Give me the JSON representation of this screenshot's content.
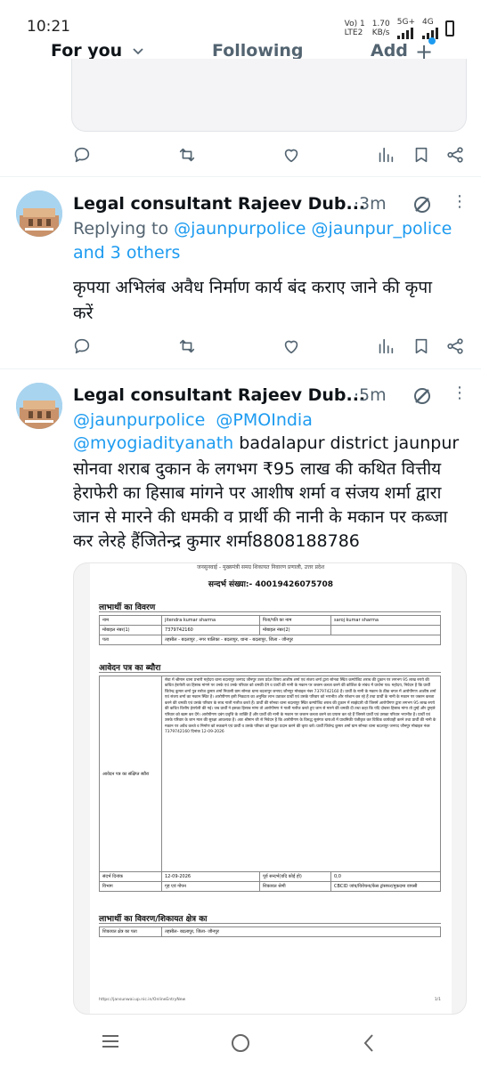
{
  "status_bar": {
    "time": "10:21",
    "volte": "Vo) 1",
    "lte": "LTE2",
    "speed": "1.70",
    "speed_unit": "KB/s",
    "net1": "5G+",
    "net2": "4G"
  },
  "tabs": {
    "for_you": "For you",
    "following": "Following",
    "add": "Add",
    "plus": "+"
  },
  "tweet2": {
    "author": "Legal consultant Rajeev Dub...",
    "age": "·3m",
    "replying_prefix": "Replying to",
    "mention1": "@jaunpurpolice",
    "mention2": "@jaunpur_police",
    "and_others": "and 3 others",
    "text_line1": "कृपया अभिलंब अवैध निर्माण कार्य बंद कराए जाने की कृपा",
    "text_line2": "करें"
  },
  "tweet3": {
    "author": "Legal consultant Rajeev Dub...",
    "age": "·5m",
    "mention1": "@jaunpurpolice",
    "mention2": "@PMOIndia",
    "mention3": "@myogiadityanath",
    "line2_rest": " badalapur district jaunpur",
    "line3": "सोनवा शराब दुकान के लगभग ₹95 लाख की कथित वित्तीय",
    "line4": "हेराफेरी का हिसाब मांगने पर आशीष शर्मा व संजय शर्मा द्वारा",
    "line5": "जान से मारने की धमकी व प्रार्थी की नानी के मकान पर कब्जा",
    "line6": "कर लेरहे हैंजितेन्द्र कुमार शर्मा8808188786"
  },
  "document": {
    "top_line": "जनसुनवाई - मुख्यमंत्री समग्र शिकायत निवारण प्रणाली, उत्तर प्रदेश",
    "reference": "सन्दर्भ संख्या:- 40019426075708",
    "section1": "लाभार्थी का विवरण",
    "name_label": "नाम",
    "name_value": "jitendra kumar sharma",
    "father_label": "पिता/पति का नाम",
    "father_value": "saroj kumar sharma",
    "mobile_label": "मोबाइल नंबर(1)",
    "mobile_value": "7379742160",
    "mobile2_label": "मोबाइल नंबर(2)",
    "mobile2_value": "",
    "address_label": "पता",
    "address_value": "तहसील - बदलापुर , नगर पालिका - बदलापुर, थाना - बदलापुर, जिला - जौनपुर",
    "section2": "आवेदन पत्र का ब्यौरा",
    "app_label": "आवेदन पत्र का संक्षिप्त ब्यौरा",
    "app_text": "सेवा में श्रीमान थाना प्रभारी महोदय थाना बदलापुर जनपद जौनपुर उत्तर प्रदेश विषय आशीष शर्मा एवं संजय शर्मा द्वारा सोनवा स्थित कम्पोजिट शराब की दुकान पर लगभग 95 लाख रुपये की कथित हेराफेरी का हिसाब मांगने पर उनके एवं उनके परिवार को धमकी देने व प्रार्थी की नानी के मकान पर जबरन कब्जा करने की कोशिश के संबंध में प्रार्थना पत्र। महोदय, निवेदन है कि प्रार्थी जितेन्द्र कुमार शर्मा पुत्र सरोज कुमार शर्मा निवासी ग्राम सोनवा थाना बदलापुर जनपद जौनपुर मोबाइल नंबर 7379742160 है। प्रार्थी के नानी के मकान के ठीक बगल में आरोपीगण आशीष शर्मा एवं संजय शर्मा का मकान स्थित है। आरोपीगण इसी निकटता का अनुचित लाभ उठाकर प्रार्थी एवं उसके परिवार को भयभीत और परेशान कर रहे हैं तथा प्रार्थी के नानी के मकान पर जबरन कब्जा करने की धमकी एवं उसके परिवार के साथ गाली गलौज करते हैं। प्रार्थी की सोनवा थाना बदलापुर स्थित कम्पोजिट शराब की दुकान में साझेदारी थी जिसमें आरोपीगण द्वारा लगभग 95 लाख रुपये की कथित वित्तीय हेराफेरी की गई। जब प्रार्थी ने इसका हिसाब मांगा तो आरोपीगण ने गाली गलौज करते हुए जान से मारने की धमकी दी तथा कहा कि यदि दोबारा हिसाब मांगा तो तुम्हें और तुम्हारे परिवार को खत्म कर देंगे। आरोपीगण दबंग प्रवृत्ति के व्यक्ति हैं और प्रार्थी की नानी के मकान पर जबरन कब्जा करने का प्रयास कर रहे हैं जिससे प्रार्थी एवं उसका परिवार भयभीत है। प्रार्थी एवं उसके परिवार के जान माल की सुरक्षा आवश्यक है। अतः श्रीमान जी से निवेदन है कि आरोपीगण के विरुद्ध सुसंगत धाराओं में प्राथमिकी पंजीकृत कर विधिक कार्यवाही करने तथा प्रार्थी की नानी के मकान पर अवैध कब्जे व निर्माण को रुकवाने एवं प्रार्थी व उसके परिवार को सुरक्षा प्रदान करने की कृपा करें। प्रार्थी जितेन्द्र कुमार शर्मा ग्राम सोनवा थाना बदलापुर जनपद जौनपुर मोबाइल नंबर 7379742160 दिनांक 12-09-2026",
    "date_label": "संदर्भ दिनांक",
    "date_value": "12-09-2026",
    "prev_label": "पूर्व सन्दर्भ(यदि कोई हो)",
    "prev_value": "0,0",
    "dept_label": "विभाग",
    "dept_value": "गृह एवं गोपन",
    "cat_label": "शिकायत श्रेणी",
    "cat_value": "CBCID जांच/विवेचना/केस ट्रांसफर/मुकदमा वापसी",
    "section3": "लाभार्थी का विवरण/शिकायत क्षेत्र का",
    "area_label": "शिकायत क्षेत्र का पता",
    "area_value": "तहसील- बदलापुर, जिला- जौनपुर",
    "footer_url": "https://jansunwai.up.nic.in/OnlineEntryNew",
    "page_no": "1/1"
  },
  "icons": [
    "reply-icon",
    "retweet-icon",
    "like-icon",
    "views-icon",
    "bookmark-icon",
    "share-icon",
    "grok-icon",
    "more-icon",
    "menu-icon",
    "home-circle-icon",
    "back-icon"
  ]
}
